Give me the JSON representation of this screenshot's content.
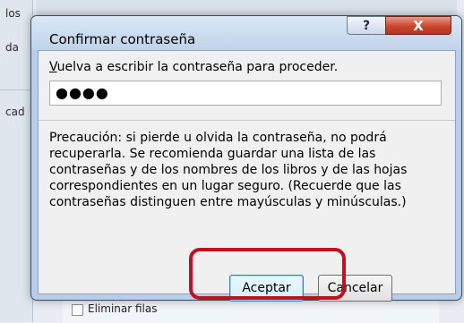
{
  "background": {
    "left_fragments": [
      "los",
      "da",
      "cad",
      "cad"
    ],
    "bottom_text": "Eliminar filas"
  },
  "dialog": {
    "title": "Confirmar contraseña",
    "help_symbol": "?",
    "close_symbol": "X",
    "prompt_accel": "V",
    "prompt_rest": "uelva a escribir la contraseña para proceder.",
    "password_value": "●●●●",
    "warning": "Precaución: si pierde u olvida la contraseña, no podrá recuperarla. Se recomienda guardar una lista de las contraseñas y de los nombres de los libros y de las hojas correspondientes en un lugar seguro. (Recuerde que las contraseñas distinguen entre mayúsculas y minúsculas.)",
    "ok_label": "Aceptar",
    "cancel_label": "Cancelar"
  },
  "colors": {
    "highlight": "#c0111f",
    "close_button": "#c9462c",
    "frame": "#b8cee8"
  }
}
